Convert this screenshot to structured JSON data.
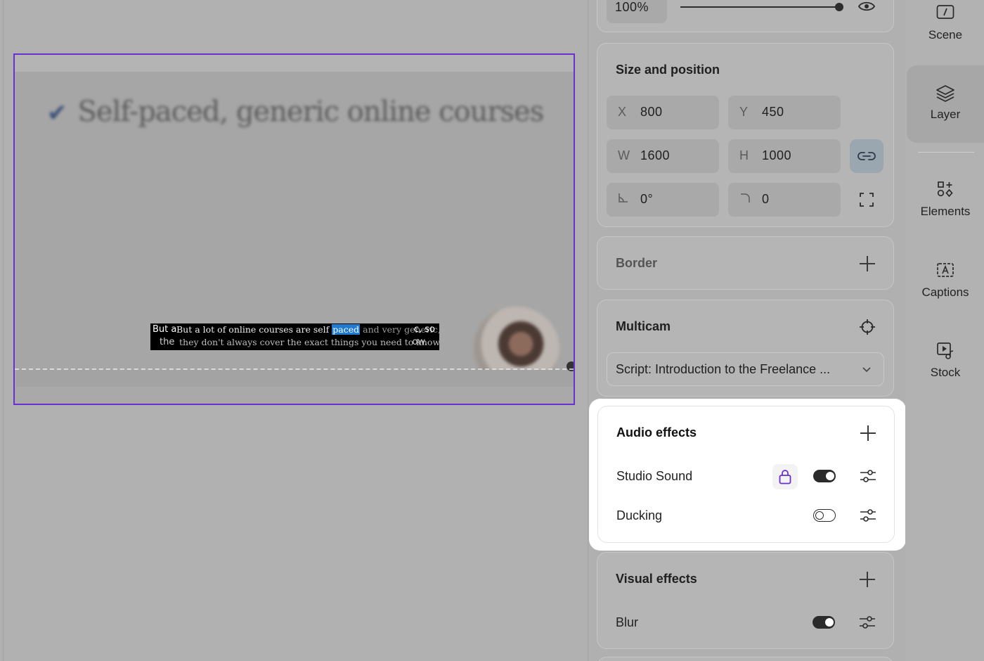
{
  "canvas": {
    "headline": "Self-paced, generic online courses",
    "caption_ghost_line1": "But a",
    "caption_ghost_line2": "the",
    "caption_line1_before": "But a lot of online courses are self",
    "caption_line1_highlight": "paced",
    "caption_line1_after": "and very generic, so",
    "caption_line1_tail": "c, so",
    "caption_line2": "they don't always cover the exact things you need to know.",
    "caption_line2_tail": "ow.",
    "frame_color": "#6a2fd0",
    "highlight_color": "#1f7ad2"
  },
  "opacity": {
    "value": "100%",
    "slider_fraction": 1.0
  },
  "size_position": {
    "title": "Size and position",
    "x_label": "X",
    "x_value": "800",
    "y_label": "Y",
    "y_value": "450",
    "w_label": "W",
    "w_value": "1600",
    "h_label": "H",
    "h_value": "1000",
    "rotation_value": "0°",
    "corner_value": "0"
  },
  "border": {
    "title": "Border"
  },
  "multicam": {
    "title": "Multicam",
    "selected": "Script: Introduction to the Freelance ..."
  },
  "audio_effects": {
    "title": "Audio effects",
    "items": [
      {
        "label": "Studio Sound",
        "enabled": true,
        "locked": true
      },
      {
        "label": "Ducking",
        "enabled": false,
        "locked": false
      }
    ]
  },
  "visual_effects": {
    "title": "Visual effects",
    "items": [
      {
        "label": "Blur",
        "enabled": true
      }
    ]
  },
  "nav": {
    "items": [
      {
        "label": "Scene",
        "icon": "scene-icon"
      },
      {
        "label": "Layer",
        "icon": "layers-icon",
        "active": true
      },
      {
        "label": "Elements",
        "icon": "elements-icon"
      },
      {
        "label": "Captions",
        "icon": "captions-icon"
      },
      {
        "label": "Stock",
        "icon": "stock-icon"
      }
    ]
  }
}
